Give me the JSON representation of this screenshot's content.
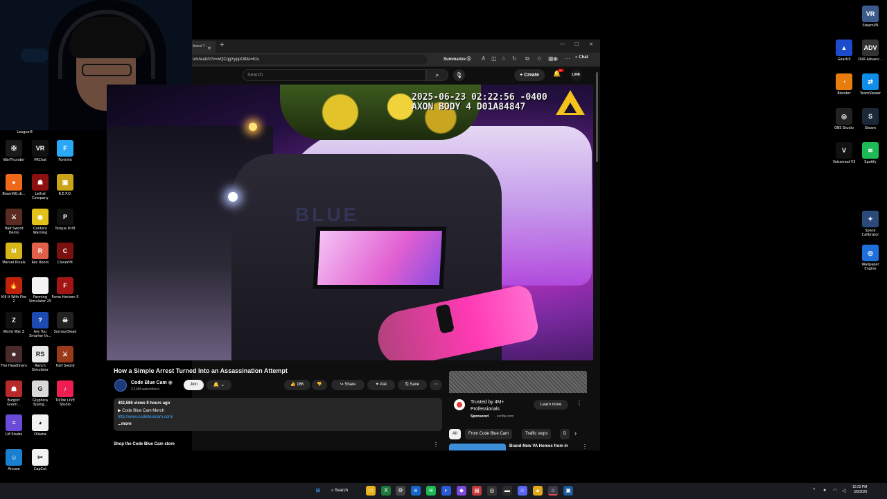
{
  "desktop_left_icons": [
    {
      "label": "League®",
      "color": "#0a0a0a",
      "glyph": ""
    },
    {
      "label": "WarThunder",
      "color": "#1a1a1a",
      "glyph": "✠"
    },
    {
      "label": "VRChat",
      "color": "#111111",
      "glyph": "VR"
    },
    {
      "label": "Fortnite",
      "color": "#2aa8f5",
      "glyph": "F"
    },
    {
      "label": "BeamNG.dr...",
      "color": "#ee6a1a",
      "glyph": "●"
    },
    {
      "label": "Lethal Company",
      "color": "#8b1111",
      "glyph": "☗"
    },
    {
      "label": "R.E.P.O.",
      "color": "#c9a319",
      "glyph": "▣"
    },
    {
      "label": "Half Sword Demo",
      "color": "#5a2b20",
      "glyph": "⚔"
    },
    {
      "label": "Content Warning",
      "color": "#e3c11a",
      "glyph": "◉"
    },
    {
      "label": "Torque Drift",
      "color": "#111111",
      "glyph": "P"
    },
    {
      "label": "Marvel Rivals",
      "color": "#d7b61a",
      "glyph": "M"
    },
    {
      "label": "Rec Room",
      "color": "#e0604a",
      "glyph": "R"
    },
    {
      "label": "CloverPit",
      "color": "#7a1010",
      "glyph": "C"
    },
    {
      "label": "Kill It With Fire 2",
      "color": "#c0230c",
      "glyph": "🔥"
    },
    {
      "label": "Farming Simulator 25",
      "color": "#f4f4f4",
      "glyph": ""
    },
    {
      "label": "Forza Horizon 5",
      "color": "#a31414",
      "glyph": "F"
    },
    {
      "label": "World War Z",
      "color": "#111111",
      "glyph": "Z"
    },
    {
      "label": "Are You Smarter th...",
      "color": "#1c4bb3",
      "glyph": "?"
    },
    {
      "label": "SurrounDead",
      "color": "#222222",
      "glyph": "☠"
    },
    {
      "label": "The Headliners",
      "color": "#4a2a2a",
      "glyph": "☻"
    },
    {
      "label": "Ranch Simulator",
      "color": "#e9e9e9",
      "glyph": "RS"
    },
    {
      "label": "Half Sword",
      "color": "#9a3a1a",
      "glyph": "⚔"
    },
    {
      "label": "Burglin' Gnom...",
      "color": "#b82a2a",
      "glyph": "☗"
    },
    {
      "label": "Glyphica Typing...",
      "color": "#d9d9d9",
      "glyph": "G"
    },
    {
      "label": "TikTok LIVE Studio",
      "color": "#ee1d52",
      "glyph": "♪"
    },
    {
      "label": "LM Studio",
      "color": "#6a4bd8",
      "glyph": "≡"
    },
    {
      "label": "Ollama",
      "color": "#f2f2f2",
      "glyph": "◕"
    },
    {
      "label": "Amuse",
      "color": "#1a7fcf",
      "glyph": "☺"
    },
    {
      "label": "CapCut",
      "color": "#f2f2f2",
      "glyph": "✂"
    }
  ],
  "desktop_right_icons": [
    {
      "label": "SteamVR",
      "color": "#3b5b8c",
      "glyph": "VR"
    },
    {
      "label": "GearUP",
      "color": "#1c4bcc",
      "glyph": "▲"
    },
    {
      "label": "OVR Advanc...",
      "color": "#333333",
      "glyph": "ADV"
    },
    {
      "label": "Blender",
      "color": "#e87d0d",
      "glyph": "◔"
    },
    {
      "label": "TeamViewer",
      "color": "#0e8ee9",
      "glyph": "⇄"
    },
    {
      "label": "OBS Studio",
      "color": "#222222",
      "glyph": "◎"
    },
    {
      "label": "Steam",
      "color": "#1b2838",
      "glyph": "S"
    },
    {
      "label": "Voicemod V3",
      "color": "#111111",
      "glyph": "V"
    },
    {
      "label": "Spotify",
      "color": "#1db954",
      "glyph": "≋"
    },
    {
      "label": "Space Calibrator",
      "color": "#2b4a7a",
      "glyph": "✦"
    },
    {
      "label": "Wallpaper Engine",
      "color": "#1e6fd9",
      "glyph": "◎"
    }
  ],
  "browser": {
    "tab_title": "Arrest T...",
    "url": "om/watch?v=wQCqgXyppO8&t=61s",
    "summarize_label": "Summarize",
    "chat_label": "Chat"
  },
  "youtube": {
    "search_placeholder": "Search",
    "create_label": "Create",
    "notification_count": "9+",
    "avatar_text": "LINK"
  },
  "video": {
    "timestamp_line1": "2025-06-23 02:22:56 -0400",
    "timestamp_line2": "AXON BODY 4 D01A84847"
  },
  "video_info": {
    "title": "How a Simple Arrest Turned Into an Assassination Attempt",
    "channel_name": "Code Blue Cam",
    "subscribers": "3.14M subscribers",
    "join_label": "Join",
    "like_count": "16K",
    "share_label": "Share",
    "ask_label": "Ask",
    "save_label": "Save",
    "views_time": "402,586 views  9 hours ago",
    "merch_line": "▶ Code Blue Cam Merch",
    "link": "http://www.codebluecam.com/",
    "more_label": "...more",
    "shop_label": "Shop the Code Blue Cam store"
  },
  "ad": {
    "title": "Trusted by 4M+ Professionals",
    "sponsored": "Sponsored",
    "domain": "· scribe.com",
    "learn_more": "Learn more"
  },
  "chips": [
    "All",
    "From Code Blue Cam",
    "Traffic stops",
    "D"
  ],
  "recommendation": {
    "title": "Brand-New VA Homes from in"
  },
  "taskbar": {
    "search_label": "Search",
    "time": "10:23 PM",
    "date": "3/9/2026"
  }
}
